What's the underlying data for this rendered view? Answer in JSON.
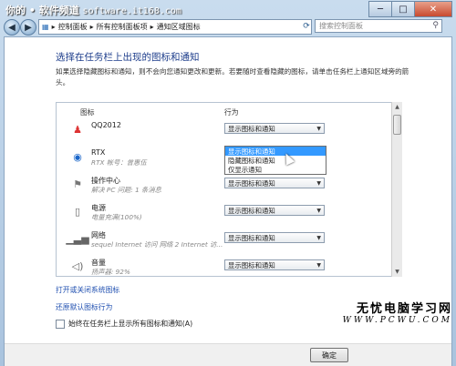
{
  "watermark": {
    "text": "你的 • 软件频道",
    "site": "software.it168.com"
  },
  "window_buttons": {
    "minimize": "─",
    "maximize": "□",
    "close": "✕"
  },
  "breadcrumb": {
    "segments": [
      "控制面板",
      "所有控制面板项",
      "通知区域图标"
    ]
  },
  "search": {
    "placeholder": "搜索控制面板"
  },
  "main": {
    "heading": "选择在任务栏上出现的图标和通知",
    "description": "如果选择隐藏图标和通知，则不会向您通知更改和更新。若要随时查看隐藏的图标，请单击任务栏上通知区域旁的箭头。",
    "col_icon": "图标",
    "col_behavior": "行为"
  },
  "rows": [
    {
      "name": "QQ2012",
      "sub": "",
      "icon": "qq-icon",
      "value": "显示图标和通知"
    },
    {
      "name": "RTX",
      "sub": "RTX 帐号：曾惠伍",
      "icon": "rtx-icon",
      "value": ""
    },
    {
      "name": "操作中心",
      "sub": "解决 PC 问题: 1 条消息",
      "icon": "flag-icon",
      "value": "显示图标和通知"
    },
    {
      "name": "电源",
      "sub": "电量充满(100%)",
      "icon": "power-icon",
      "value": "显示图标和通知"
    },
    {
      "name": "网络",
      "sub": "sequel Internet 访问 网络 2 Internet 访...",
      "icon": "network-icon",
      "value": "显示图标和通知"
    },
    {
      "name": "音量",
      "sub": "扬声器: 92%",
      "icon": "speaker-icon",
      "value": "显示图标和通知"
    }
  ],
  "dropdown_options": [
    "显示图标和通知",
    "隐藏图标和通知",
    "仅显示通知"
  ],
  "dropdown_selected_index": 0,
  "links": {
    "system_icons": "打开或关闭系统图标",
    "restore": "还原默认图标行为"
  },
  "checkbox": {
    "label": "始终在任务栏上显示所有图标和通知(A)",
    "checked": false
  },
  "buttons": {
    "ok": "确定"
  },
  "brand": {
    "name": "无忧电脑学习网",
    "url": "WWW.PCWU.COM"
  },
  "colors": {
    "link": "#1f4fb0",
    "heading": "#1d3d8b",
    "selection": "#3399ff"
  }
}
